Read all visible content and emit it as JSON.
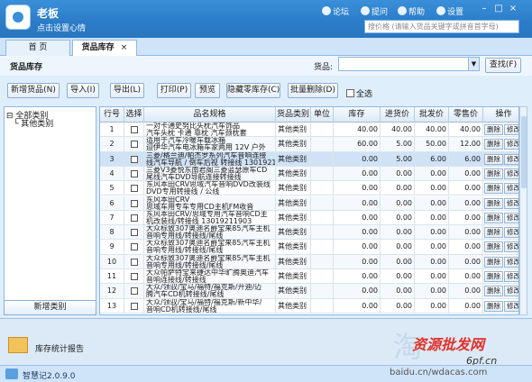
{
  "app": {
    "title": "老板",
    "subtitle": "点击设置心情",
    "search_placeholder": "搜价格 (请输入货品关键字或拼音首字母)"
  },
  "top": {
    "forum": "论坛",
    "ask": "提问",
    "help": "帮助",
    "settings": "设置"
  },
  "tabs": [
    {
      "label": "首 页"
    },
    {
      "label": "货品库存"
    }
  ],
  "header": {
    "title": "货品库存",
    "goods_label": "货品:",
    "query": "查找(F)"
  },
  "toolbar": {
    "add": "新增货品(N)",
    "import": "导入(I)",
    "export": "导出(L)",
    "print": "打印(P)",
    "preview": "预览",
    "hide_zero": "隐藏零库存(C)",
    "batch_delete": "批量删除(D)",
    "select_all": "全选"
  },
  "categories": {
    "root": "全部类别",
    "child": "其他类别",
    "new": "新增类别"
  },
  "columns": [
    "行号",
    "选择",
    "品名规格",
    "货品类别",
    "单位",
    "库存",
    "进货价",
    "批发价",
    "零售价",
    "操作"
  ],
  "rows": [
    {
      "no": "1",
      "name1": "一对卡通史努比头枕汽车饰品",
      "name2": "汽车头枕 卡通 靠枕 汽车颈枕套",
      "cat": "其他类别",
      "stock": "40.00",
      "buy": "40.00",
      "whole": "40.00",
      "retail": "40.00"
    },
    {
      "no": "2",
      "name1": "适用于汽车冷暖车载冰箱",
      "name2": "迎伊华汽车电冰箱车家两用 12V 户外",
      "cat": "其他类别",
      "stock": "60.00",
      "buy": "5.00",
      "whole": "50.00",
      "retail": "12.00"
    },
    {
      "no": "3",
      "name1": "三菱/格兰迪/帕杰罗系列汽车音响连接",
      "name2": "线汽车导航 / 倒车后视 转接线 13019211903",
      "cat": "其他类别",
      "stock": "0.00",
      "buy": "5.00",
      "whole": "6.00",
      "retail": "6.00"
    },
    {
      "no": "4",
      "name1": "三菱V3菱悦东南君阁三菱蓝瑟原车CD",
      "name2": "尾线汽车DVD导航连接转接线",
      "cat": "其他类别",
      "stock": "0.00",
      "buy": "0.00",
      "whole": "0.00",
      "retail": "0.00"
    },
    {
      "no": "5",
      "name1": "东风本田CRV思域汽车音响DVD改装线",
      "name2": "DVD专用转接线 / 公线",
      "cat": "其他类别",
      "stock": "0.00",
      "buy": "0.00",
      "whole": "0.00",
      "retail": "0.00"
    },
    {
      "no": "6",
      "name1": "东风本田CRV",
      "name2": "思域车用专车专用CD主机FM收音",
      "cat": "其他类别",
      "stock": "0.00",
      "buy": "0.00",
      "whole": "0.00",
      "retail": "0.00"
    },
    {
      "no": "7",
      "name1": "东风本田CRV/思域专用汽车音响CD主",
      "name2": "机改装线/转接线 13019211903",
      "cat": "其他类别",
      "stock": "0.00",
      "buy": "0.00",
      "whole": "0.00",
      "retail": "0.00"
    },
    {
      "no": "8",
      "name1": "大众标致307奥迪名爵宝来85汽车主机",
      "name2": "音响专用线/转接线/尾线",
      "cat": "其他类别",
      "stock": "0.00",
      "buy": "0.00",
      "whole": "0.00",
      "retail": "0.00"
    },
    {
      "no": "9",
      "name1": "大众标致307奥迪名爵宝来85汽车主机",
      "name2": "音响专用线/转接线/尾线",
      "cat": "其他类别",
      "stock": "0.00",
      "buy": "0.00",
      "whole": "0.00",
      "retail": "0.00"
    },
    {
      "no": "10",
      "name1": "大众标致307奥迪名爵宝来85汽车主机",
      "name2": "音响专用线/转接线/尾线",
      "cat": "其他类别",
      "stock": "0.00",
      "buy": "0.00",
      "whole": "0.00",
      "retail": "0.00"
    },
    {
      "no": "11",
      "name1": "大众帕萨特宝来捷达中华旷腾奥迪汽车",
      "name2": "音响连接线/转接线",
      "cat": "其他类别",
      "stock": "0.00",
      "buy": "0.00",
      "whole": "0.00",
      "retail": "0.00"
    },
    {
      "no": "12",
      "name1": "大众/领驭/宝马/福特/福克斯/开迪/迈",
      "name2": "腾汽车CD机转接线/尾线",
      "cat": "其他类别",
      "stock": "0.00",
      "buy": "0.00",
      "whole": "0.00",
      "retail": "0.00"
    },
    {
      "no": "13",
      "name1": "大众/领驭/宝马/福特/福克斯/新中华/",
      "name2": "音响CD机转接线/尾线",
      "cat": "其他类别",
      "stock": "0.00",
      "buy": "0.00",
      "whole": "0.00",
      "retail": "0.00"
    }
  ],
  "ops": {
    "delete": "删除",
    "edit": "修改"
  },
  "footer": {
    "report": "库存统计报告",
    "version": "智慧记2.0.9.0"
  },
  "watermark": {
    "line1": "资源批发网",
    "line2": "6pf.cn",
    "line3": "baidu.cn/wdacas.com",
    "big": "淘"
  }
}
